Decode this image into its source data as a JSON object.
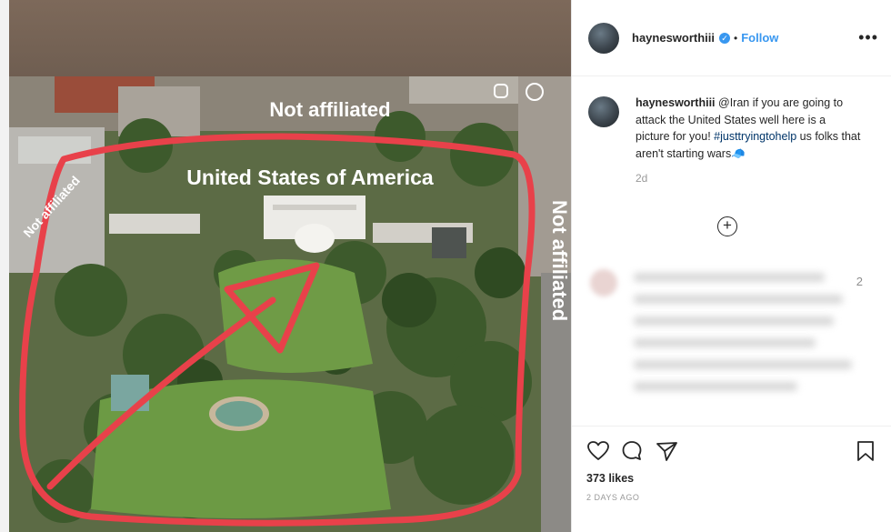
{
  "post": {
    "username": "haynesworthiii",
    "verified_mark": "✓",
    "separator": "•",
    "follow_label": "Follow",
    "more_label": "•••",
    "caption_username": "haynesworthiii",
    "caption_text": " @Iran if you are going to attack the United States well here is a picture for you! ",
    "caption_hashtag": "#justtryingtohelp",
    "caption_tail": " us folks that aren't starting wars🧢",
    "caption_time": "2d",
    "load_more": "+",
    "blurred_comment_count": "2",
    "likes": "373 likes",
    "posted_ago": "2 DAYS AGO",
    "icons": [
      "heart-icon",
      "comment-icon",
      "share-icon",
      "bookmark-icon",
      "more-icon",
      "verified-icon",
      "add-comments-icon"
    ],
    "accent_color": "#3897f0"
  },
  "image": {
    "label_top": "Not affiliated",
    "label_center": "United States of America",
    "label_left": "Not affiliated",
    "label_right": "Not affiliated",
    "annotation_color": "#e8414a"
  }
}
